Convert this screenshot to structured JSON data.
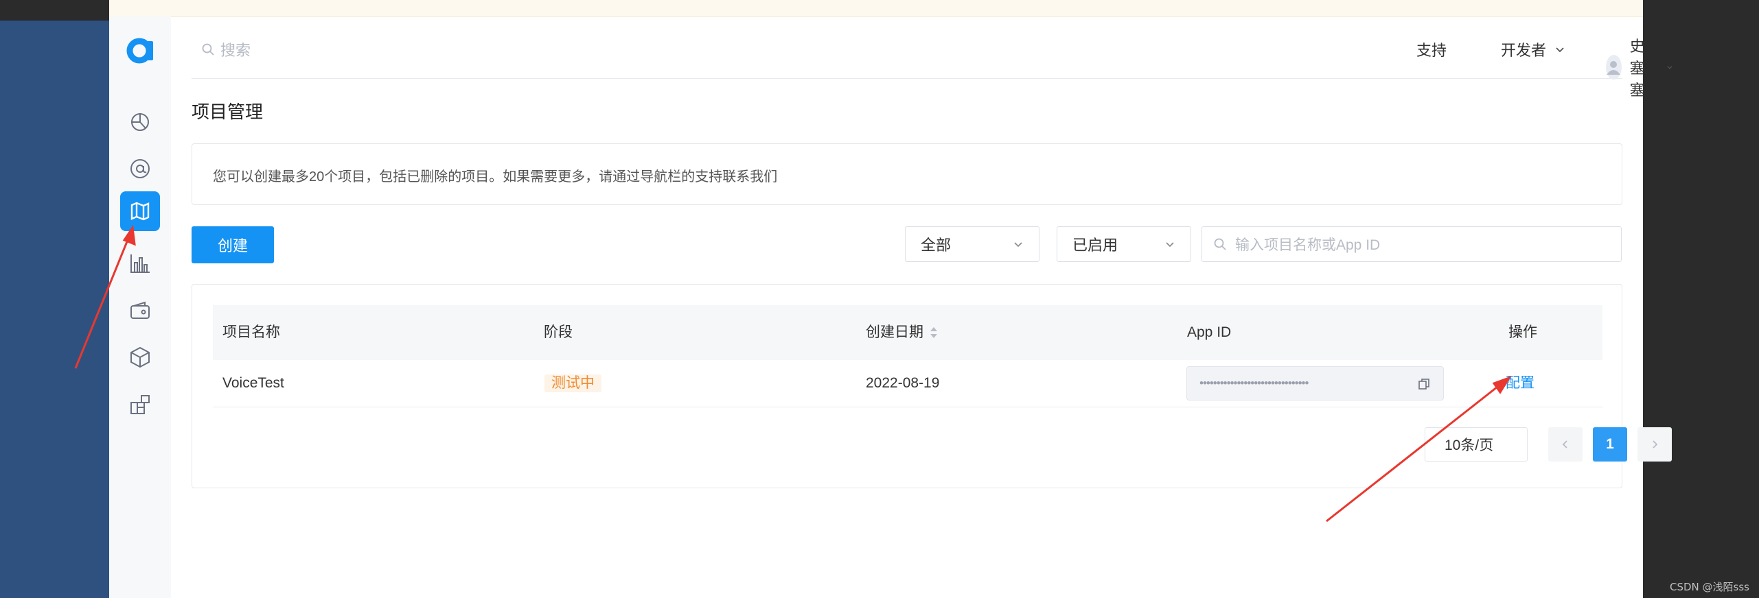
{
  "header": {
    "search_placeholder": "搜索",
    "support_label": "支持",
    "developer_label": "开发者",
    "user_name": "史塞塞"
  },
  "sidebar": {
    "items": [
      {
        "icon": "dashboard-icon"
      },
      {
        "icon": "at-icon"
      },
      {
        "icon": "map-icon",
        "active": true
      },
      {
        "icon": "bar-chart-icon"
      },
      {
        "icon": "wallet-icon"
      },
      {
        "icon": "cube-icon"
      },
      {
        "icon": "apps-grid-icon"
      }
    ]
  },
  "page": {
    "title": "项目管理",
    "notice": "您可以创建最多20个项目，包括已删除的项目。如果需要更多，请通过导航栏的支持联系我们",
    "create_label": "创建",
    "filter_scope": "全部",
    "filter_status": "已启用",
    "filter_placeholder": "输入项目名称或App ID"
  },
  "table": {
    "columns": [
      "项目名称",
      "阶段",
      "创建日期",
      "App ID",
      "操作"
    ],
    "rows": [
      {
        "name": "VoiceTest",
        "stage": "测试中",
        "date": "2022-08-19",
        "app_id_masked": "••••••••••••••••••••••••••••••••",
        "action": "配置"
      }
    ]
  },
  "pagination": {
    "page_size": "10条/页",
    "current_page": "1"
  },
  "watermark": "CSDN @浅陌sss",
  "colors": {
    "accent": "#1593f4",
    "stage_badge_text": "#f08b2f",
    "annotation_arrow": "#e8382f"
  }
}
